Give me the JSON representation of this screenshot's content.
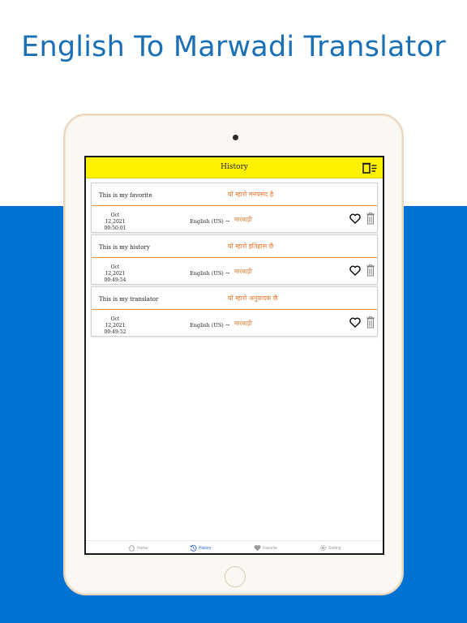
{
  "headline": "English To Marwadi Translator",
  "appbar": {
    "title": "History",
    "clear_icon": "clear-all-icon"
  },
  "history": [
    {
      "source": "This is my favorite",
      "translation": "यो म्हारो मनपसंद है",
      "date": "Oct 12,2021",
      "time": "00:50:01",
      "from_lang": "English (US) →",
      "to_lang": "मारवाड़ी"
    },
    {
      "source": "This is my history",
      "translation": "यो म्हारो इतिहास छै",
      "date": "Oct 12,2021",
      "time": "00:49:54",
      "from_lang": "English (US) →",
      "to_lang": "मारवाड़ी"
    },
    {
      "source": "This is my translator",
      "translation": "यो म्हारो अनुवादक छै",
      "date": "Oct 12,2021",
      "time": "00:49:52",
      "from_lang": "English (US) →",
      "to_lang": "मारवाड़ी"
    }
  ],
  "nav": [
    {
      "label": "Home",
      "icon": "home-icon"
    },
    {
      "label": "History",
      "icon": "history-icon"
    },
    {
      "label": "Favorite",
      "icon": "heart-icon"
    },
    {
      "label": "Setting",
      "icon": "gear-icon"
    }
  ],
  "colors": {
    "appbar": "#fff200",
    "accent": "#e8772e",
    "brand_blue": "#0072d6",
    "nav_active": "#2a69c8"
  }
}
